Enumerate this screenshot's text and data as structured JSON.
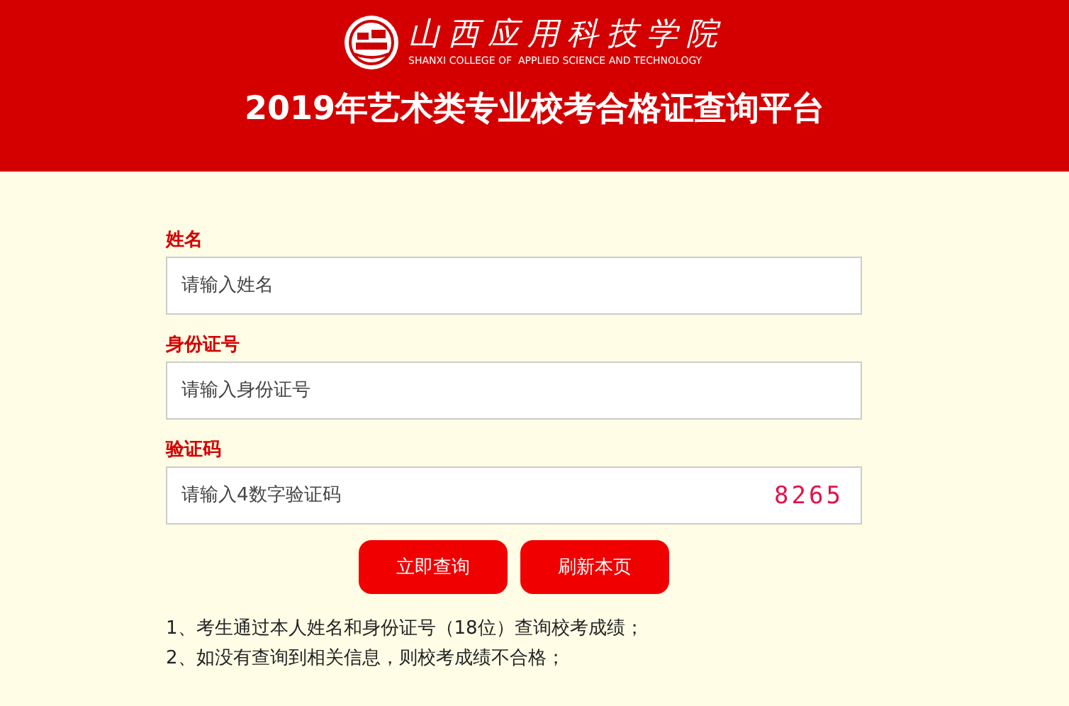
{
  "header": {
    "logo_name": "山西应用科技学院",
    "logo_subtitle": "SHANXI COLLEGE OF  APPLIED SCIENCE AND TECHNOLOGY",
    "title": "2019年艺术类专业校考合格证查询平台"
  },
  "fields": [
    {
      "label": "姓名",
      "placeholder": "请输入姓名",
      "kind": "text"
    },
    {
      "label": "身份证号",
      "placeholder": "请输入身份证号",
      "kind": "text"
    },
    {
      "label": "验证码",
      "placeholder": "请输入4数字验证码",
      "kind": "captcha",
      "captcha": "8265"
    }
  ],
  "buttons": [
    "立即查询",
    "刷新本页"
  ],
  "notes": [
    "1、考生通过本人姓名和身份证号（18位）查询校考成绩；",
    "2、如没有查询到相关信息，则校考成绩不合格；"
  ]
}
